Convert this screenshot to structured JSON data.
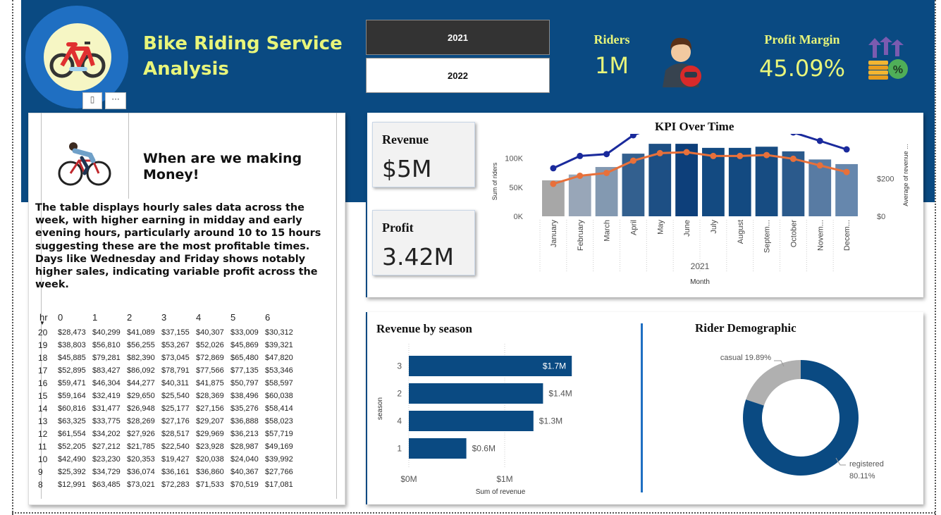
{
  "header": {
    "title": "Bike Riding Service Analysis",
    "year_buttons": [
      "2021",
      "2022"
    ],
    "riders_label": "Riders",
    "riders_value": "1M",
    "profit_margin_label": "Profit Margin",
    "profit_margin_value": "45.09%",
    "colors": {
      "background": "#0a4a82",
      "accent": "#e8f57a",
      "logo_ring": "#1f6fc2"
    },
    "icons": [
      "bike-icon",
      "rider-helmet-icon",
      "profit-coins-icon"
    ]
  },
  "visual_menu": {
    "icons": [
      "focus-mode-icon",
      "more-options-icon"
    ],
    "more_label": "···"
  },
  "insight": {
    "title": "When are we making Money!",
    "text": "The table displays hourly sales data across the week, with higher earning in midday and early evening hours, particularly around 10 to 15 hours suggesting these are the most profitable times. Days like Wednesday and Friday shows notably higher sales, indicating variable profit across the week.",
    "icon": "cyclist-icon"
  },
  "matrix": {
    "row_header": "hr",
    "columns": [
      "0",
      "1",
      "2",
      "3",
      "4",
      "5",
      "6"
    ],
    "rows": [
      {
        "hr": "20",
        "values": [
          "$28,473",
          "$40,299",
          "$41,089",
          "$37,155",
          "$40,307",
          "$33,009",
          "$30,312"
        ]
      },
      {
        "hr": "19",
        "values": [
          "$38,803",
          "$56,810",
          "$56,255",
          "$53,267",
          "$52,026",
          "$45,869",
          "$39,321"
        ]
      },
      {
        "hr": "18",
        "values": [
          "$45,885",
          "$79,281",
          "$82,390",
          "$73,045",
          "$72,869",
          "$65,480",
          "$47,820"
        ]
      },
      {
        "hr": "17",
        "values": [
          "$52,895",
          "$83,427",
          "$86,092",
          "$78,791",
          "$77,566",
          "$77,135",
          "$53,346"
        ]
      },
      {
        "hr": "16",
        "values": [
          "$59,471",
          "$46,304",
          "$44,277",
          "$40,311",
          "$41,875",
          "$50,797",
          "$58,597"
        ]
      },
      {
        "hr": "15",
        "values": [
          "$59,164",
          "$32,419",
          "$29,650",
          "$25,540",
          "$28,369",
          "$38,496",
          "$60,038"
        ]
      },
      {
        "hr": "14",
        "values": [
          "$60,816",
          "$31,477",
          "$26,948",
          "$25,177",
          "$27,156",
          "$35,276",
          "$58,414"
        ]
      },
      {
        "hr": "13",
        "values": [
          "$63,325",
          "$33,775",
          "$28,269",
          "$27,176",
          "$29,207",
          "$36,888",
          "$58,023"
        ]
      },
      {
        "hr": "12",
        "values": [
          "$61,554",
          "$34,202",
          "$27,926",
          "$28,517",
          "$29,969",
          "$36,213",
          "$57,719"
        ]
      },
      {
        "hr": "11",
        "values": [
          "$52,205",
          "$27,212",
          "$21,785",
          "$22,540",
          "$23,928",
          "$28,987",
          "$49,169"
        ]
      },
      {
        "hr": "10",
        "values": [
          "$42,490",
          "$23,230",
          "$20,353",
          "$19,427",
          "$20,038",
          "$24,040",
          "$39,992"
        ]
      },
      {
        "hr": "9",
        "values": [
          "$25,392",
          "$34,729",
          "$36,074",
          "$36,161",
          "$36,860",
          "$40,367",
          "$27,766"
        ]
      },
      {
        "hr": "8",
        "values": [
          "$12,991",
          "$63,485",
          "$73,021",
          "$72,283",
          "$71,533",
          "$70,519",
          "$17,081"
        ]
      }
    ]
  },
  "kpis": {
    "revenue_label": "Revenue",
    "revenue_value": "$5M",
    "profit_label": "Profit",
    "profit_value": "3.42M"
  },
  "chart_data": [
    {
      "type": "bar",
      "title": "KPI Over Time",
      "xlabel": "Month",
      "x_group_label": "2021",
      "ylabel": "Sum of riders",
      "y2label": "Average of revenue ...",
      "categories": [
        "January",
        "February",
        "March",
        "April",
        "May",
        "June",
        "July",
        "August",
        "Septem...",
        "October",
        "Novem...",
        "Decem..."
      ],
      "yticks": [
        "0K",
        "50K",
        "100K"
      ],
      "y2ticks": [
        "$0",
        "$200"
      ],
      "ylim": [
        0,
        130000
      ],
      "y2lim": [
        0,
        400
      ],
      "series": [
        {
          "name": "Sum of riders",
          "kind": "bar",
          "values": [
            62000,
            72000,
            85000,
            108000,
            125000,
            125000,
            118000,
            118000,
            120000,
            112000,
            98000,
            90000
          ],
          "colors": [
            "#a7a7a7",
            "#98a6b8",
            "#8399b1",
            "#33608f",
            "#1d4f84",
            "#0d3f7a",
            "#134a81",
            "#134a81",
            "#174c82",
            "#2b5a8c",
            "#587ba3",
            "#6687ad"
          ]
        },
        {
          "name": "Average of revenue",
          "kind": "line",
          "axis": "right",
          "color": "#1a2a9c",
          "values": [
            255,
            320,
            330,
            430,
            485,
            495,
            470,
            470,
            480,
            445,
            400,
            355
          ]
        },
        {
          "name": "line-2",
          "kind": "line",
          "axis": "right",
          "color": "#e8703a",
          "values": [
            172,
            215,
            230,
            295,
            335,
            340,
            320,
            320,
            325,
            305,
            270,
            235
          ]
        }
      ],
      "grid": false
    },
    {
      "type": "bar",
      "orientation": "horizontal",
      "title": "Revenue by season",
      "ylabel": "season",
      "xlabel": "Sum of revenue",
      "categories": [
        "3",
        "2",
        "4",
        "1"
      ],
      "values": [
        1.7,
        1.4,
        1.3,
        0.6
      ],
      "data_labels": [
        "$1.7M",
        "$1.4M",
        "$1.3M",
        "$0.6M"
      ],
      "xticks": [
        "$0M",
        "$1M"
      ],
      "xlim": [
        0,
        2.0
      ],
      "color": "#0a4a82"
    },
    {
      "type": "pie",
      "donut": true,
      "title": "Rider Demographic",
      "slices": [
        {
          "label": "casual",
          "value": 19.89,
          "display": "casual 19.89%",
          "color": "#b0b0b0"
        },
        {
          "label": "registered",
          "value": 80.11,
          "display_line1": "registered",
          "display_line2": "80.11%",
          "color": "#0a4a82"
        }
      ]
    }
  ]
}
